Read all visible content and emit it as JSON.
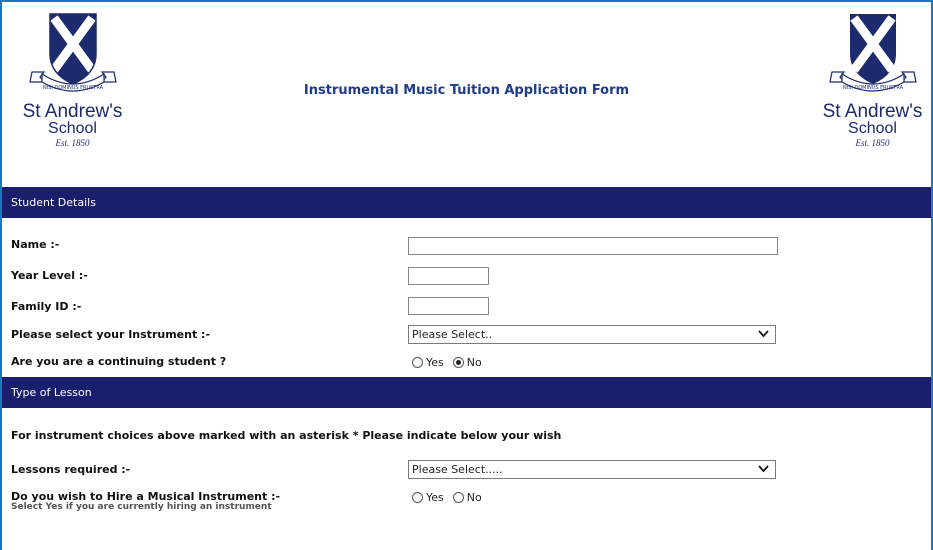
{
  "header": {
    "title": "Instrumental Music Tuition Application Form",
    "crest": {
      "motto": "NISI DOMINUS FRUSTRA",
      "name": "St Andrew's",
      "school": "School",
      "est": "Est. 1850"
    }
  },
  "sections": {
    "student": {
      "title": "Student Details"
    },
    "lesson": {
      "title": "Type of Lesson"
    }
  },
  "student": {
    "name_label": "Name :-",
    "name_value": "",
    "year_label": "Year Level :-",
    "year_value": "",
    "family_label": "Family ID :-",
    "family_value": "",
    "instrument_label": "Please select your Instrument :-",
    "instrument_selected": "Please Select..",
    "continuing_label": "Are you are a continuing student ?",
    "continuing_yes": "Yes",
    "continuing_no": "No",
    "continuing_selected": "No"
  },
  "lesson": {
    "note": "For instrument choices above marked with an asterisk * Please indicate below your wish",
    "lessons_label": "Lessons required :-",
    "lessons_selected": "Please Select.....",
    "hire_label": "Do you wish to Hire a Musical Instrument :-",
    "hire_sub": "Select Yes if you are currently hiring an instrument",
    "hire_yes": "Yes",
    "hire_no": "No",
    "hire_selected": ""
  },
  "colors": {
    "section_bar": "#191f6c",
    "title": "#1f3c8c",
    "crest": "#1e2a6e",
    "frame": "#1a78c2"
  },
  "icons": [
    "crest-logo",
    "chevron-down-icon",
    "radio-button"
  ]
}
